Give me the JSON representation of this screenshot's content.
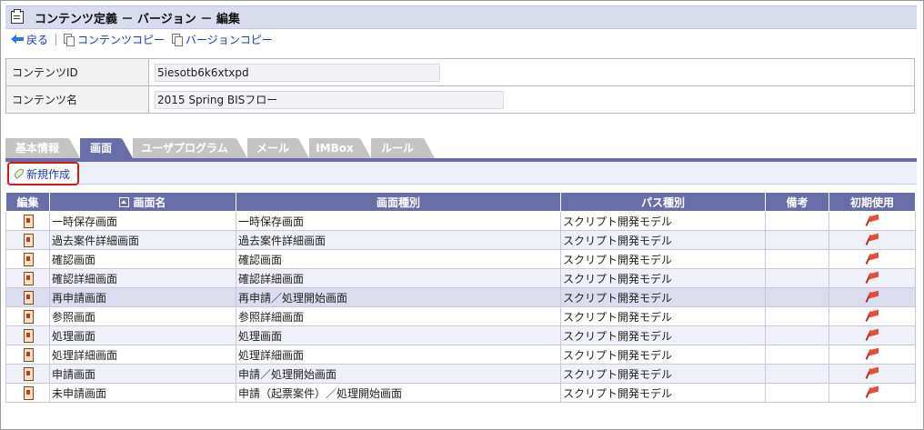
{
  "title": "コンテンツ定義 － バージョン － 編集",
  "toolbar": {
    "back": "戻る",
    "content_copy": "コンテンツコピー",
    "version_copy": "バージョンコピー"
  },
  "info": {
    "id_label": "コンテンツID",
    "id_value": "5iesotb6k6xtxpd",
    "name_label": "コンテンツ名",
    "name_value": "2015 Spring BISフロー"
  },
  "tabs": [
    "基本情報",
    "画面",
    "ユーザプログラム",
    "メール",
    "IMBox",
    "ルール"
  ],
  "selected_tab": "画面",
  "new_button": "新規作成",
  "columns": [
    "編集",
    "画面名",
    "画面種別",
    "パス種別",
    "備考",
    "初期使用"
  ],
  "rows": [
    {
      "name": "一時保存画面",
      "type": "一時保存画面",
      "path": "スクリプト開発モデル",
      "note": ""
    },
    {
      "name": "過去案件詳細画面",
      "type": "過去案件詳細画面",
      "path": "スクリプト開発モデル",
      "note": ""
    },
    {
      "name": "確認画面",
      "type": "確認画面",
      "path": "スクリプト開発モデル",
      "note": ""
    },
    {
      "name": "確認詳細画面",
      "type": "確認詳細画面",
      "path": "スクリプト開発モデル",
      "note": ""
    },
    {
      "name": "再申請画面",
      "type": "再申請／処理開始画面",
      "path": "スクリプト開発モデル",
      "note": ""
    },
    {
      "name": "参照画面",
      "type": "参照詳細画面",
      "path": "スクリプト開発モデル",
      "note": ""
    },
    {
      "name": "処理画面",
      "type": "処理画面",
      "path": "スクリプト開発モデル",
      "note": ""
    },
    {
      "name": "処理詳細画面",
      "type": "処理詳細画面",
      "path": "スクリプト開発モデル",
      "note": ""
    },
    {
      "name": "申請画面",
      "type": "申請／処理開始画面",
      "path": "スクリプト開発モデル",
      "note": ""
    },
    {
      "name": "未申請画面",
      "type": "申請（起票案件）／処理開始画面",
      "path": "スクリプト開発モデル",
      "note": ""
    }
  ]
}
